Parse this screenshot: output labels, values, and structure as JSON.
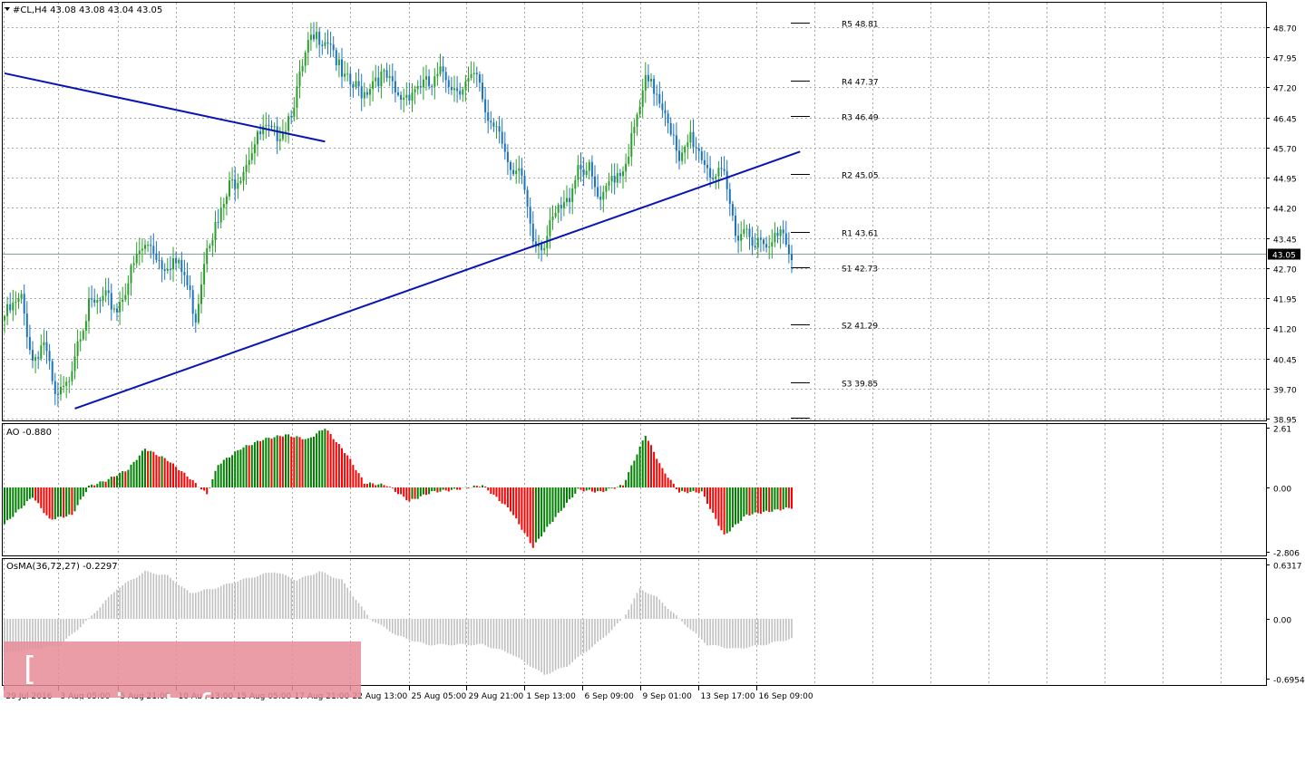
{
  "chart_data": [
    {
      "type": "candlestick",
      "title": "#CL,H4  43.08 43.08 43.04 43.05",
      "symbol": "#CL,H4",
      "ohlc": [
        43.08,
        43.08,
        43.04,
        43.05
      ],
      "ylim": [
        38.95,
        49.03
      ],
      "yticks": [
        "48.70",
        "47.95",
        "47.20",
        "46.45",
        "45.70",
        "44.95",
        "44.20",
        "43.45",
        "42.70",
        "41.95",
        "41.20",
        "40.45",
        "39.70",
        "38.95"
      ],
      "current_price": "43.05",
      "x_labels": [
        "29 Jul 2016",
        "3 Aug 05:00",
        "5 Aug 21:00",
        "10 Aug 13:00",
        "15 Aug 05:00",
        "17 Aug 21:00",
        "22 Aug 13:00",
        "25 Aug 05:00",
        "29 Aug 21:00",
        "1 Sep 13:00",
        "6 Sep 09:00",
        "9 Sep 01:00",
        "13 Sep 17:00",
        "16 Sep 09:00"
      ],
      "pivot_levels": [
        {
          "label": "R5 48.81",
          "value": 48.81
        },
        {
          "label": "R4 47.37",
          "value": 47.37
        },
        {
          "label": "R3 46.49",
          "value": 46.49
        },
        {
          "label": "R2 45.05",
          "value": 45.05
        },
        {
          "label": "R1 43.61",
          "value": 43.61
        },
        {
          "label": "S1 42.73",
          "value": 42.73
        },
        {
          "label": "S2 41.29",
          "value": 41.29
        },
        {
          "label": "S3 39.85",
          "value": 39.85
        }
      ],
      "trendlines": [
        {
          "name": "resistance",
          "from": {
            "bar": 0,
            "price": 47.55
          },
          "to": {
            "bar": 114,
            "price": 45.85
          }
        },
        {
          "name": "support",
          "from": {
            "bar": 25,
            "price": 39.2
          },
          "to": {
            "bar": 283,
            "price": 45.6
          }
        }
      ],
      "close_path": [
        [
          0,
          41.5
        ],
        [
          6,
          41.9
        ],
        [
          10,
          40.4
        ],
        [
          14,
          40.9
        ],
        [
          18,
          39.4
        ],
        [
          22,
          39.7
        ],
        [
          26,
          41.0
        ],
        [
          30,
          41.7
        ],
        [
          36,
          41.9
        ],
        [
          40,
          41.7
        ],
        [
          44,
          42.4
        ],
        [
          48,
          43.1
        ],
        [
          52,
          43.3
        ],
        [
          56,
          42.8
        ],
        [
          60,
          42.9
        ],
        [
          64,
          42.5
        ],
        [
          68,
          41.5
        ],
        [
          72,
          43.4
        ],
        [
          76,
          43.8
        ],
        [
          80,
          44.7
        ],
        [
          84,
          45.1
        ],
        [
          88,
          45.7
        ],
        [
          92,
          46.1
        ],
        [
          96,
          46.0
        ],
        [
          100,
          46.3
        ],
        [
          104,
          47.1
        ],
        [
          108,
          48.2
        ],
        [
          112,
          48.5
        ],
        [
          116,
          48.4
        ],
        [
          120,
          47.4
        ],
        [
          124,
          47.2
        ],
        [
          128,
          47.1
        ],
        [
          132,
          47.5
        ],
        [
          136,
          47.4
        ],
        [
          140,
          46.9
        ],
        [
          144,
          47.1
        ],
        [
          148,
          47.3
        ],
        [
          152,
          47.2
        ],
        [
          156,
          47.6
        ],
        [
          160,
          47.2
        ],
        [
          164,
          47.3
        ],
        [
          168,
          47.4
        ],
        [
          172,
          46.4
        ],
        [
          176,
          46.3
        ],
        [
          180,
          44.9
        ],
        [
          184,
          45.0
        ],
        [
          188,
          43.5
        ],
        [
          192,
          43.3
        ],
        [
          196,
          44.0
        ],
        [
          200,
          44.3
        ],
        [
          204,
          45.3
        ],
        [
          208,
          45.1
        ],
        [
          212,
          44.2
        ],
        [
          216,
          45.0
        ],
        [
          220,
          45.2
        ],
        [
          224,
          46.1
        ],
        [
          228,
          47.3
        ],
        [
          232,
          47.1
        ],
        [
          236,
          46.5
        ],
        [
          240,
          45.2
        ],
        [
          244,
          46.0
        ],
        [
          248,
          45.5
        ],
        [
          252,
          45.0
        ],
        [
          256,
          44.9
        ],
        [
          260,
          43.6
        ],
        [
          264,
          43.7
        ],
        [
          268,
          43.3
        ],
        [
          272,
          43.1
        ],
        [
          276,
          43.8
        ],
        [
          280,
          43.05
        ]
      ]
    },
    {
      "type": "bar",
      "title": "AO -0.880",
      "yticks": [
        "2.61",
        "0.00",
        "-2.806"
      ],
      "ylim": [
        -3.1,
        3.1
      ],
      "up_color": "#008000",
      "down_color": "#ff0000",
      "anchors": [
        [
          0,
          -1.6
        ],
        [
          10,
          -0.4
        ],
        [
          16,
          -1.4
        ],
        [
          24,
          -1.2
        ],
        [
          30,
          0.05
        ],
        [
          36,
          0.3
        ],
        [
          44,
          0.8
        ],
        [
          50,
          1.7
        ],
        [
          58,
          1.2
        ],
        [
          66,
          0.4
        ],
        [
          72,
          -0.3
        ],
        [
          76,
          1.0
        ],
        [
          84,
          1.7
        ],
        [
          92,
          2.1
        ],
        [
          100,
          2.3
        ],
        [
          108,
          2.1
        ],
        [
          114,
          2.6
        ],
        [
          122,
          1.4
        ],
        [
          128,
          0.2
        ],
        [
          136,
          0.1
        ],
        [
          144,
          -0.6
        ],
        [
          152,
          -0.2
        ],
        [
          160,
          -0.1
        ],
        [
          170,
          0.1
        ],
        [
          180,
          -1.0
        ],
        [
          188,
          -2.6
        ],
        [
          194,
          -1.6
        ],
        [
          204,
          -0.1
        ],
        [
          212,
          -0.2
        ],
        [
          220,
          0.1
        ],
        [
          228,
          2.3
        ],
        [
          234,
          0.8
        ],
        [
          240,
          -0.2
        ],
        [
          248,
          -0.2
        ],
        [
          256,
          -2.1
        ],
        [
          264,
          -1.2
        ],
        [
          280,
          -0.88
        ]
      ]
    },
    {
      "type": "histogram",
      "title": "OsMA(36,72,27) -0.2297",
      "yticks": [
        "0.6317",
        "0.00",
        "-0.6954"
      ],
      "ylim": [
        -0.6954,
        0.6317
      ],
      "color": "#c0c0c0",
      "anchors": [
        [
          0,
          -0.4
        ],
        [
          10,
          -0.35
        ],
        [
          20,
          -0.3
        ],
        [
          30,
          0.0
        ],
        [
          40,
          0.35
        ],
        [
          50,
          0.55
        ],
        [
          58,
          0.5
        ],
        [
          66,
          0.3
        ],
        [
          74,
          0.35
        ],
        [
          84,
          0.45
        ],
        [
          96,
          0.55
        ],
        [
          104,
          0.45
        ],
        [
          112,
          0.55
        ],
        [
          120,
          0.45
        ],
        [
          130,
          0.0
        ],
        [
          140,
          -0.2
        ],
        [
          150,
          -0.3
        ],
        [
          160,
          -0.3
        ],
        [
          170,
          -0.3
        ],
        [
          180,
          -0.4
        ],
        [
          192,
          -0.65
        ],
        [
          200,
          -0.55
        ],
        [
          212,
          -0.25
        ],
        [
          220,
          0.0
        ],
        [
          226,
          0.35
        ],
        [
          232,
          0.25
        ],
        [
          240,
          0.0
        ],
        [
          250,
          -0.3
        ],
        [
          260,
          -0.35
        ],
        [
          270,
          -0.3
        ],
        [
          280,
          -0.23
        ]
      ]
    }
  ],
  "panels": {
    "ao_label": "AO -0.880",
    "osma_label": "OsMA(36,72,27) -0.2297"
  },
  "watermark": "[ www.instaforex.com ]"
}
